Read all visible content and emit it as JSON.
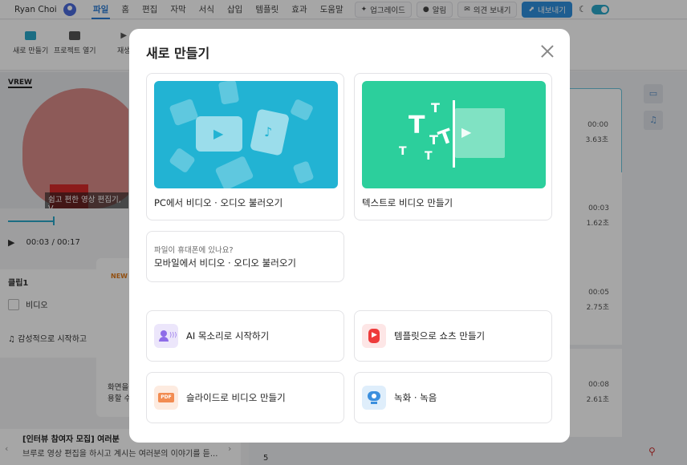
{
  "topbar": {
    "user_name": "Ryan Choi",
    "menu": [
      "파일",
      "홈",
      "편집",
      "자막",
      "서식",
      "삽입",
      "템플릿",
      "효과",
      "도움말"
    ],
    "active_menu": "파일",
    "upgrade_label": "업그레이드",
    "alarm_label": "알림",
    "feedback_label": "의견 보내기",
    "export_label": "내보내기"
  },
  "toolbar": {
    "new_label": "새로 만들기",
    "open_label": "프로젝트 열기",
    "play_label": "재생"
  },
  "preview": {
    "caption": "쉽고 편한 영상 편집기, V",
    "time_current": "00:03",
    "time_total": "/ 00:17",
    "logo_text": "VREW"
  },
  "clip_panel": {
    "title": "클립1",
    "video_label": "비디오",
    "music_label": "감성적으로 시작하고"
  },
  "new_card": {
    "badge": "NEW",
    "text_line1": "화면을",
    "text_line2": "용할 수"
  },
  "notice": {
    "title": "[인터뷰 참여자 모집] 여러분",
    "body": "브루로 영상 편집을 하시고 계시는 여러분의 이야기를 듣..."
  },
  "clips": [
    {
      "time": "00:00",
      "duration": "3.63초"
    },
    {
      "time": "00:03",
      "duration": "1.62초"
    },
    {
      "time": "00:05",
      "duration": "2.75초"
    },
    {
      "time": "00:08",
      "duration": "2.61초"
    }
  ],
  "row_number": "5",
  "modal": {
    "title": "새로 만들기",
    "pc_import_label": "PC에서 비디오 · 오디오 불러오기",
    "text_to_video_label": "텍스트로 비디오 만들기",
    "mobile_sub": "파일이 휴대폰에 있나요?",
    "mobile_main": "모바일에서 비디오 · 오디오 불러오기",
    "ai_voice_label": "AI 목소리로 시작하기",
    "template_shorts_label": "템플릿으로 쇼츠 만들기",
    "slides_label": "슬라이드로 비디오 만들기",
    "record_label": "녹화 · 녹음",
    "colors": {
      "pc_thumb": "#22b3d3",
      "text_thumb": "#2ccf9c",
      "ai_icon_bg": "#ece6fb",
      "shorts_icon_bg": "#fde6e6",
      "slides_icon_bg": "#fdebe0",
      "record_icon_bg": "#dfeefb"
    }
  }
}
